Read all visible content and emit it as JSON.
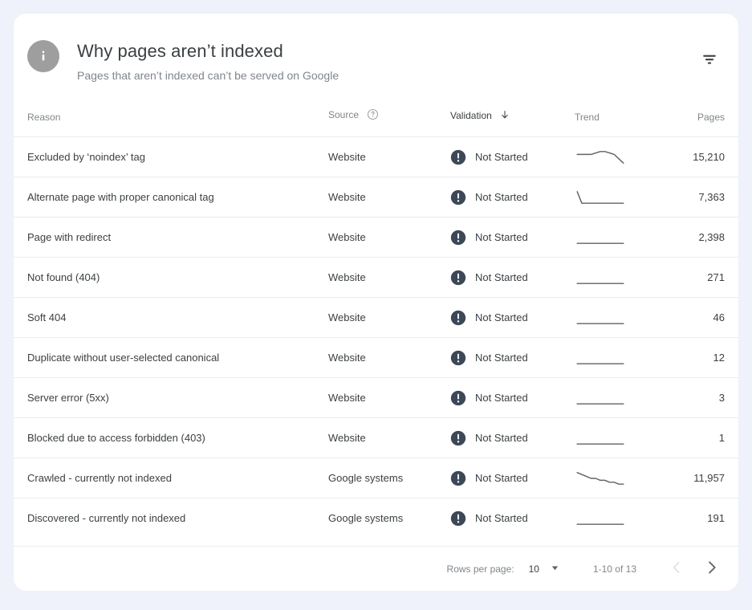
{
  "header": {
    "icon": "info-icon",
    "title": "Why pages aren’t indexed",
    "subtitle": "Pages that aren’t indexed can’t be served on Google",
    "filter_icon": "filter-icon"
  },
  "table": {
    "columns": [
      {
        "key": "reason",
        "label": "Reason",
        "sorted": false,
        "help": false
      },
      {
        "key": "source",
        "label": "Source",
        "sorted": false,
        "help": true,
        "help_icon": "help-circle-icon"
      },
      {
        "key": "validation",
        "label": "Validation",
        "sorted": true,
        "sort_icon": "arrow-down-icon",
        "help": false
      },
      {
        "key": "trend",
        "label": "Trend",
        "sorted": false,
        "help": false
      },
      {
        "key": "pages",
        "label": "Pages",
        "sorted": false,
        "help": false
      }
    ],
    "rows": [
      {
        "reason": "Excluded by ‘noindex’ tag",
        "source": "Website",
        "validation": "Not Started",
        "status_icon": "error-exclamation-icon",
        "pages": "15,210",
        "trend": [
          10,
          10,
          10,
          10,
          11,
          12,
          12,
          11,
          10,
          7,
          4
        ]
      },
      {
        "reason": "Alternate page with proper canonical tag",
        "source": "Website",
        "validation": "Not Started",
        "status_icon": "error-exclamation-icon",
        "pages": "7,363",
        "trend": [
          10,
          8,
          8,
          8,
          8,
          8,
          8,
          8,
          8,
          8,
          8
        ]
      },
      {
        "reason": "Page with redirect",
        "source": "Website",
        "validation": "Not Started",
        "status_icon": "error-exclamation-icon",
        "pages": "2,398",
        "trend": [
          8,
          8,
          8,
          8,
          8,
          8,
          8,
          8,
          8,
          8,
          8
        ]
      },
      {
        "reason": "Not found (404)",
        "source": "Website",
        "validation": "Not Started",
        "status_icon": "error-exclamation-icon",
        "pages": "271",
        "trend": [
          8,
          8,
          8,
          8,
          8,
          8,
          8,
          8,
          8,
          8,
          8
        ]
      },
      {
        "reason": "Soft 404",
        "source": "Website",
        "validation": "Not Started",
        "status_icon": "error-exclamation-icon",
        "pages": "46",
        "trend": [
          8,
          8,
          8,
          8,
          8,
          8,
          8,
          8,
          8,
          8,
          8
        ]
      },
      {
        "reason": "Duplicate without user-selected canonical",
        "source": "Website",
        "validation": "Not Started",
        "status_icon": "error-exclamation-icon",
        "pages": "12",
        "trend": [
          8,
          8,
          8,
          8,
          8,
          8,
          8,
          8,
          8,
          8,
          8
        ]
      },
      {
        "reason": "Server error (5xx)",
        "source": "Website",
        "validation": "Not Started",
        "status_icon": "error-exclamation-icon",
        "pages": "3",
        "trend": [
          8,
          8,
          8,
          8,
          8,
          8,
          8,
          8,
          8,
          8,
          8
        ]
      },
      {
        "reason": "Blocked due to access forbidden (403)",
        "source": "Website",
        "validation": "Not Started",
        "status_icon": "error-exclamation-icon",
        "pages": "1",
        "trend": [
          8,
          8,
          8,
          8,
          8,
          8,
          8,
          8,
          8,
          8,
          8
        ]
      },
      {
        "reason": "Crawled - currently not indexed",
        "source": "Google systems",
        "validation": "Not Started",
        "status_icon": "error-exclamation-icon",
        "pages": "11,957",
        "trend": [
          12,
          11,
          10,
          9,
          9,
          8,
          8,
          7,
          7,
          6,
          6
        ]
      },
      {
        "reason": "Discovered - currently not indexed",
        "source": "Google systems",
        "validation": "Not Started",
        "status_icon": "error-exclamation-icon",
        "pages": "191",
        "trend": [
          8,
          8,
          8,
          8,
          8,
          8,
          8,
          8,
          8,
          8,
          8
        ]
      }
    ]
  },
  "footer": {
    "rows_per_page_label": "Rows per page:",
    "rows_per_page_value": "10",
    "dropdown_icon": "chevron-down-icon",
    "range_label": "1-10 of 13",
    "prev_icon": "chevron-left-icon",
    "next_icon": "chevron-right-icon",
    "prev_enabled": false,
    "next_enabled": true
  },
  "colors": {
    "page_background": "#eff2fa",
    "card_background": "#ffffff",
    "text_primary": "#3c4043",
    "text_secondary": "#80868b",
    "divider": "#ebebf2",
    "status_icon": "#3c4858",
    "info_icon": "#9e9e9e",
    "sparkline": "#5f6368",
    "pager_disabled": "#dadce0",
    "pager_enabled": "#5f6368"
  }
}
